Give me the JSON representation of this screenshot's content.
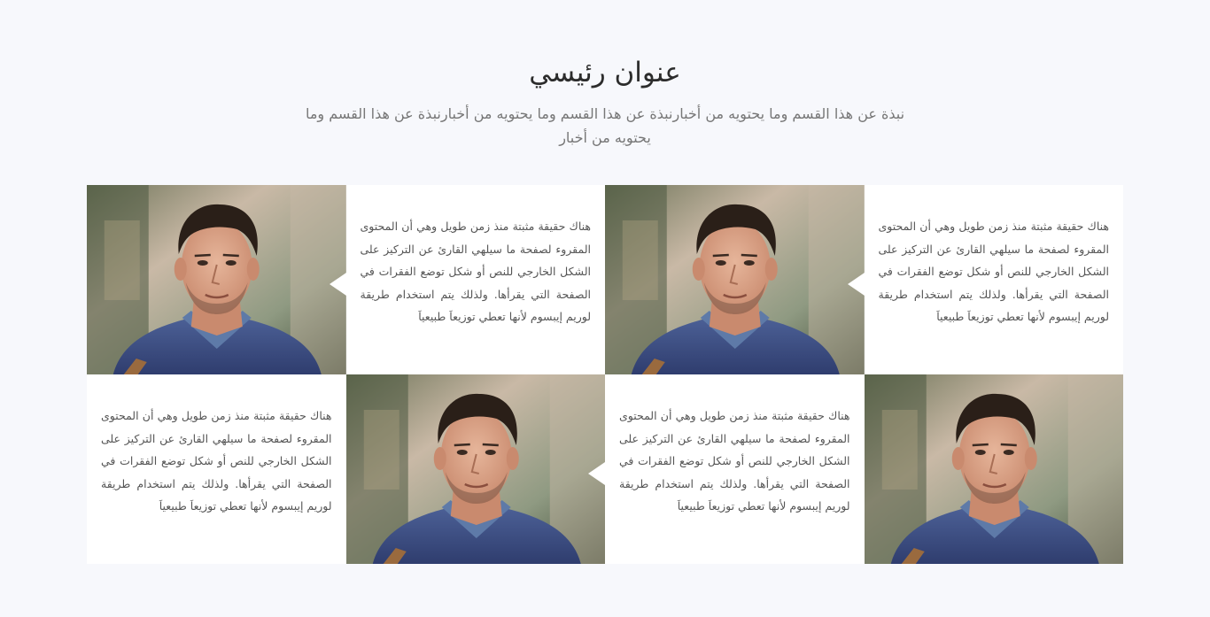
{
  "section": {
    "title": "عنوان رئيسي",
    "subtitle": "نبذة عن هذا القسم وما يحتويه من أخبارنبذة عن هذا القسم وما يحتويه من أخبارنبذة عن هذا القسم وما يحتويه من أخبار"
  },
  "cards": [
    {
      "text": "هناك حقيقة مثبتة منذ زمن طويل وهي أن المحتوى المقروء لصفحة ما سيلهي القارئ عن التركيز على الشكل الخارجي للنص أو شكل توضع الفقرات في الصفحة التي يقرأها. ولذلك يتم استخدام طريقة لوريم إيبسوم لأنها تعطي توزيعاَ طبيعياَ",
      "photo": "man-portrait-photo"
    },
    {
      "text": "هناك حقيقة مثبتة منذ زمن طويل وهي أن المحتوى المقروء لصفحة ما سيلهي القارئ عن التركيز على الشكل الخارجي للنص أو شكل توضع الفقرات في الصفحة التي يقرأها. ولذلك يتم استخدام طريقة لوريم إيبسوم لأنها تعطي توزيعاَ طبيعياَ",
      "photo": "man-portrait-photo"
    },
    {
      "text": "هناك حقيقة مثبتة منذ زمن طويل وهي أن المحتوى المقروء لصفحة ما سيلهي القارئ عن التركيز على الشكل الخارجي للنص أو شكل توضع الفقرات في الصفحة التي يقرأها. ولذلك يتم استخدام طريقة لوريم إيبسوم لأنها تعطي توزيعاَ طبيعياَ",
      "photo": "man-portrait-photo"
    },
    {
      "text": "هناك حقيقة مثبتة منذ زمن طويل وهي أن المحتوى المقروء لصفحة ما سيلهي القارئ عن التركيز على الشكل الخارجي للنص أو شكل توضع الفقرات في الصفحة التي يقرأها. ولذلك يتم استخدام طريقة لوريم إيبسوم لأنها تعطي توزيعاَ طبيعياَ",
      "photo": "man-portrait-photo"
    }
  ],
  "colors": {
    "background": "#f7f8fc",
    "card": "#ffffff",
    "title": "#2c2c2c",
    "subtitle": "#777777",
    "body_text": "#555555"
  }
}
